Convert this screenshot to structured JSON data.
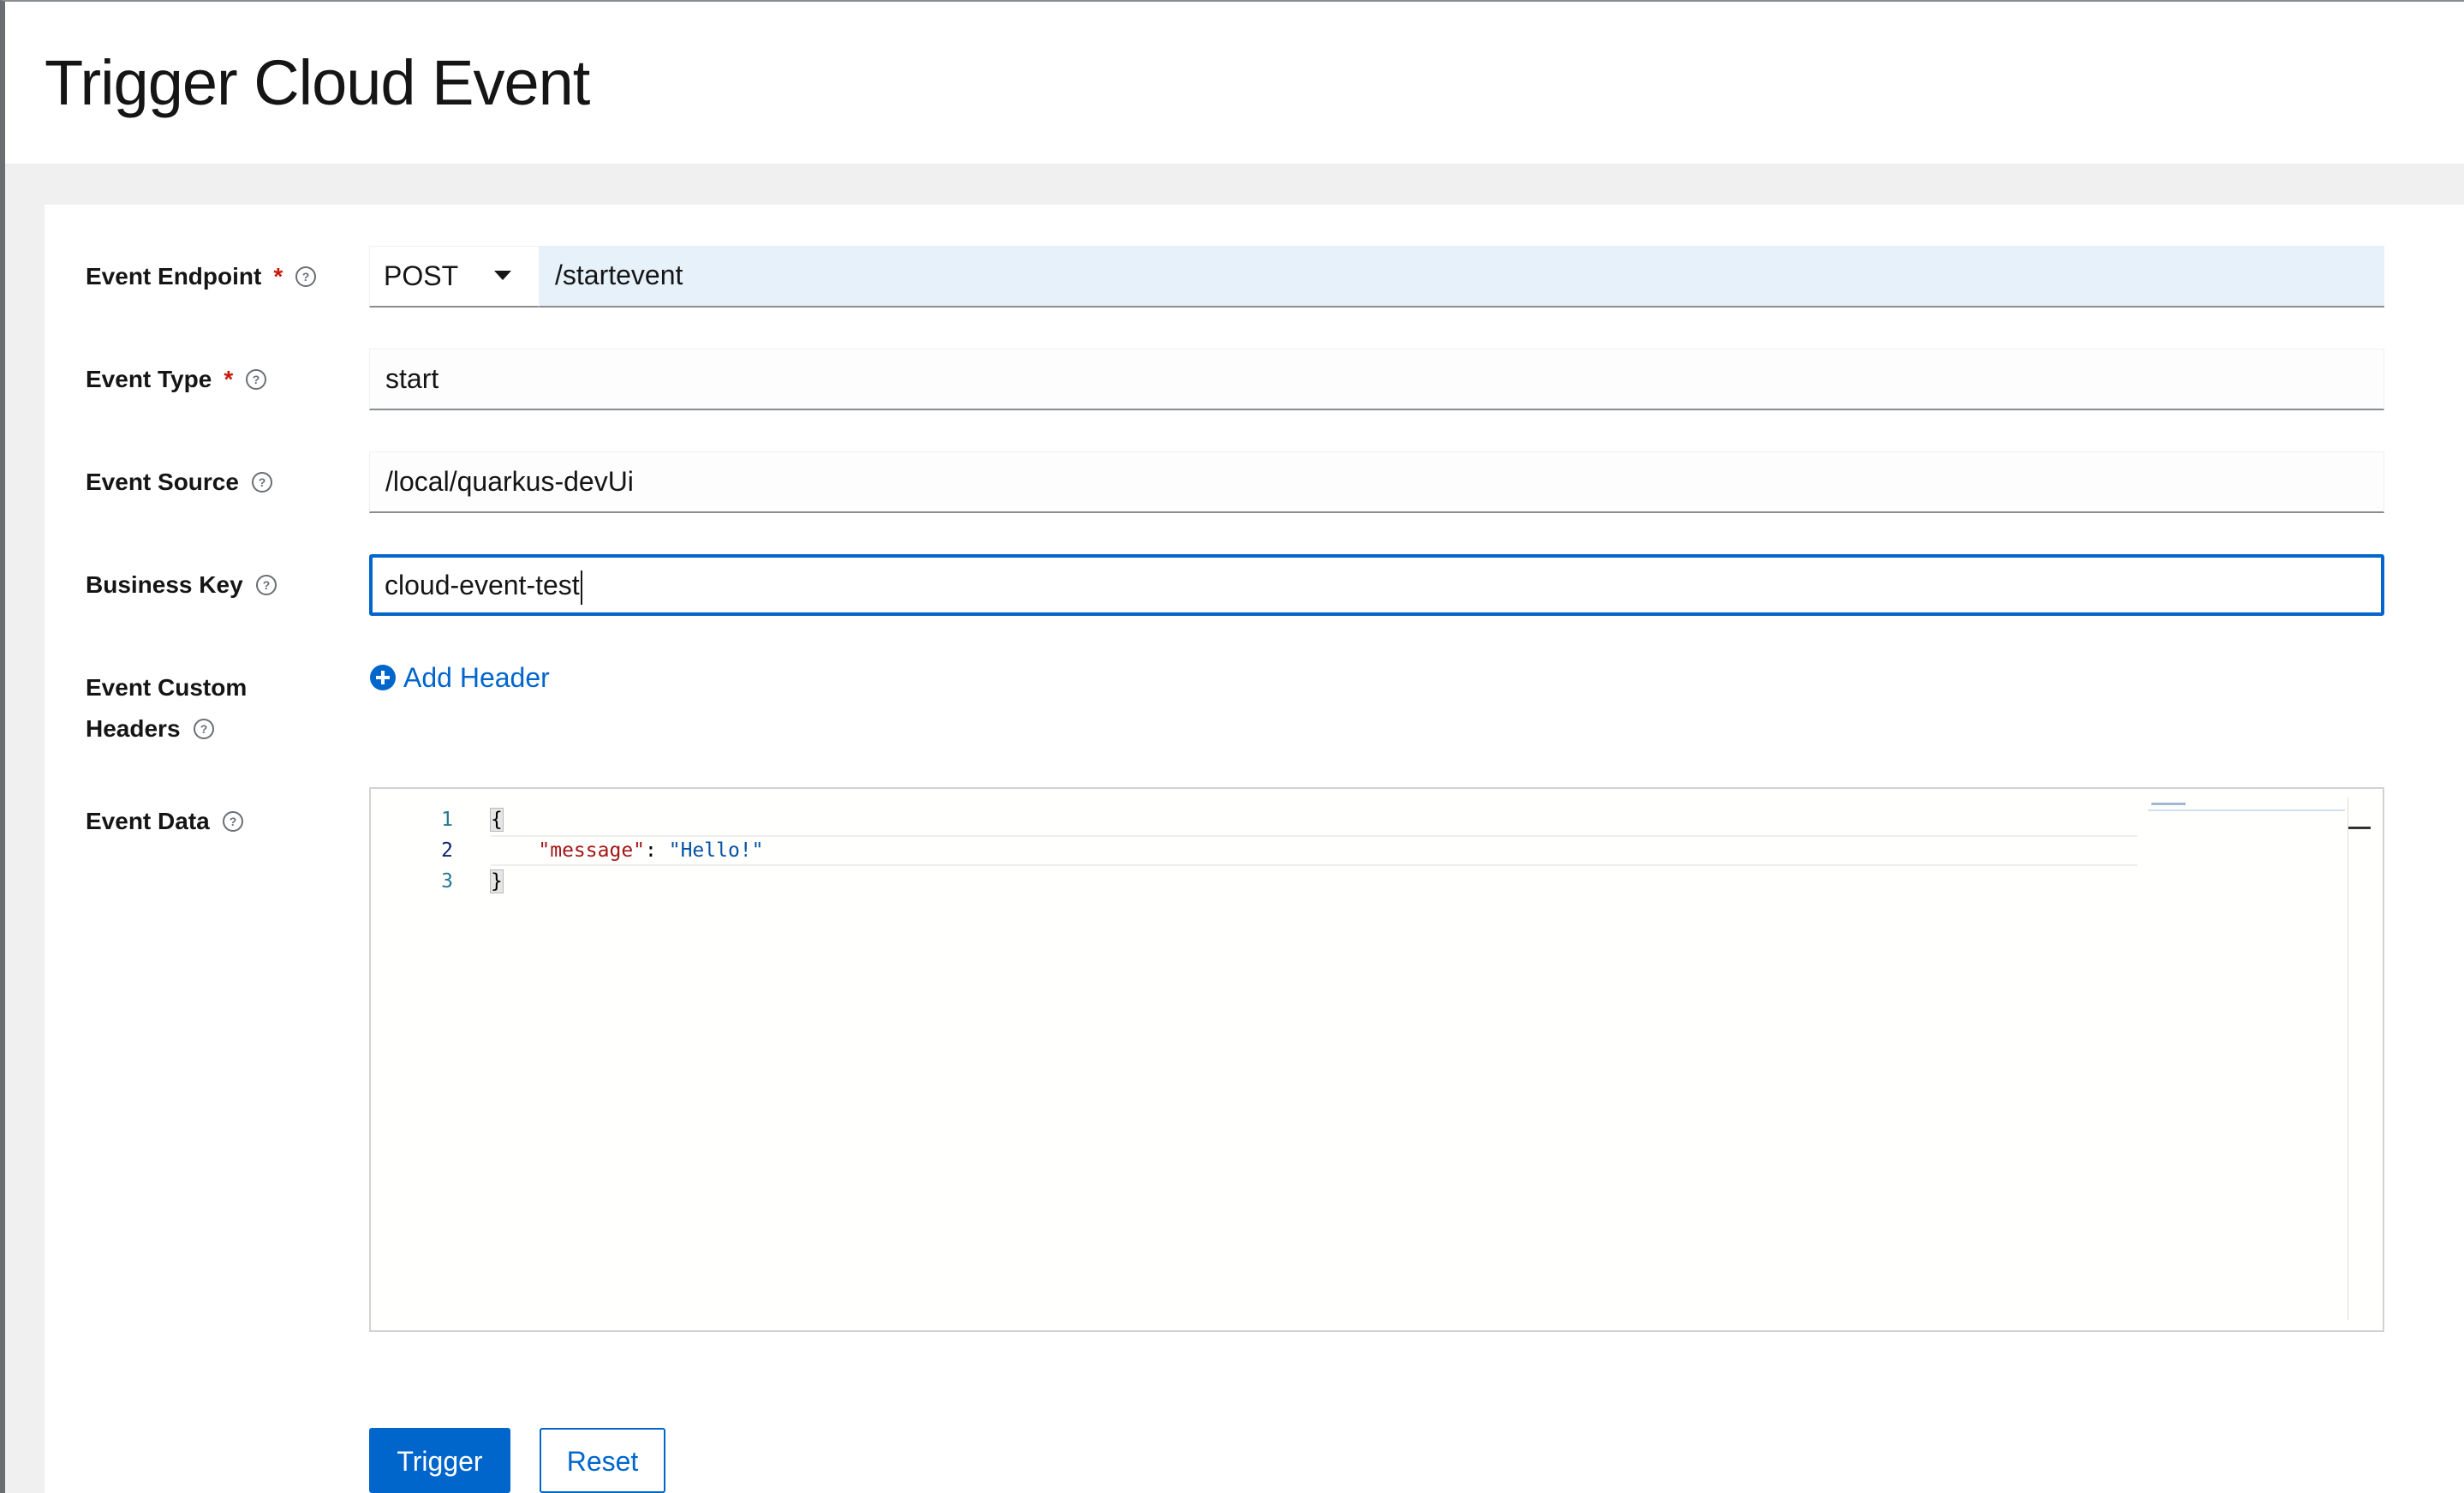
{
  "page": {
    "title": "Trigger Cloud Event"
  },
  "form": {
    "endpoint": {
      "label": "Event Endpoint",
      "required_mark": "*",
      "method": "POST",
      "path": "/startevent"
    },
    "event_type": {
      "label": "Event Type",
      "required_mark": "*",
      "value": "start"
    },
    "event_source": {
      "label": "Event Source",
      "value": "/local/quarkus-devUi"
    },
    "business_key": {
      "label": "Business Key",
      "value": "cloud-event-test"
    },
    "custom_headers": {
      "label_line1": "Event Custom",
      "label_line2": "Headers",
      "add_label": "Add Header"
    },
    "event_data": {
      "label": "Event Data",
      "line_numbers": [
        "1",
        "2",
        "3"
      ],
      "line1": "{",
      "line2_key": "\"message\"",
      "line2_sep": ": ",
      "line2_value": "\"Hello!\"",
      "line3": "}"
    }
  },
  "actions": {
    "trigger_label": "Trigger",
    "reset_label": "Reset"
  },
  "colors": {
    "primary": "#0066cc",
    "required": "#c9190b",
    "json_key": "#a31515",
    "json_string": "#0451a5",
    "line_number": "#237893"
  },
  "icons": {
    "help": "question-circle-icon",
    "add": "plus-circle-icon",
    "dropdown": "caret-down-icon"
  }
}
